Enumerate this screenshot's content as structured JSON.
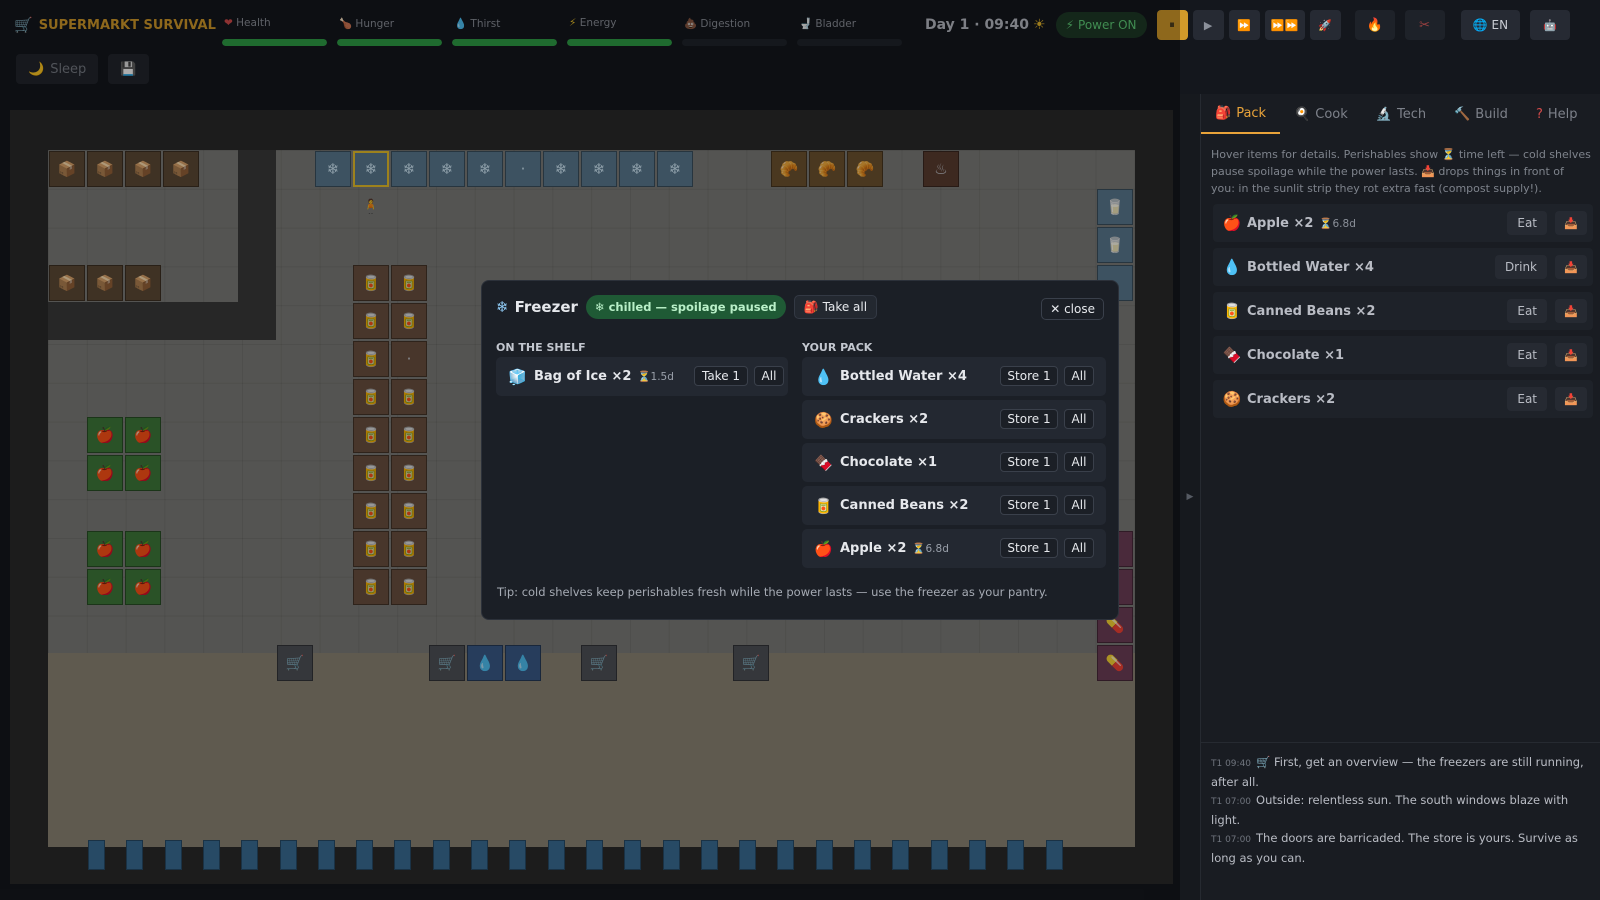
{
  "app": {
    "title": "SUPERMARKT SURVIVAL",
    "title_icon": "cart-icon"
  },
  "stats": [
    {
      "label": "Health",
      "icon": "heart-icon",
      "fill_fraction": 1.0
    },
    {
      "label": "Hunger",
      "icon": "drumstick-icon",
      "fill_fraction": 1.0
    },
    {
      "label": "Thirst",
      "icon": "droplet-icon",
      "fill_fraction": 1.0
    },
    {
      "label": "Energy",
      "icon": "bolt-icon",
      "fill_fraction": 1.0
    },
    {
      "label": "Digestion",
      "icon": "poop-icon",
      "fill_fraction": 0.0
    },
    {
      "label": "Bladder",
      "icon": "toilet-icon",
      "fill_fraction": 0.0
    }
  ],
  "clock": {
    "text": "Day 1 · 09:40"
  },
  "power": {
    "label": "Power ON",
    "color": "#5fce78"
  },
  "speed_controls": {
    "pause": "⏸",
    "play": "▶",
    "fast": "⏩",
    "fastest": "⏩⏩",
    "rocket": "🚀"
  },
  "lang": {
    "label": "EN"
  },
  "toolbar": {
    "sleep_label": "Sleep"
  },
  "modal": {
    "title": "Freezer",
    "badge": "chilled — spoilage paused",
    "take_all": "Take all",
    "close": "close",
    "shelf_title": "ON THE SHELF",
    "pack_title": "YOUR PACK",
    "shelf": [
      {
        "name": "Bag of Ice ×2",
        "time": "1.5d",
        "icon": "ice-icon",
        "take1": "Take 1",
        "all": "All"
      }
    ],
    "pack": [
      {
        "name": "Bottled Water ×4",
        "time": "",
        "icon": "water-drop-icon",
        "store1": "Store 1",
        "all": "All"
      },
      {
        "name": "Crackers ×2",
        "time": "",
        "icon": "crackers-icon",
        "store1": "Store 1",
        "all": "All"
      },
      {
        "name": "Chocolate ×1",
        "time": "",
        "icon": "chocolate-icon",
        "store1": "Store 1",
        "all": "All"
      },
      {
        "name": "Canned Beans ×2",
        "time": "",
        "icon": "can-icon",
        "store1": "Store 1",
        "all": "All"
      },
      {
        "name": "Apple ×2",
        "time": "6.8d",
        "icon": "apple-icon",
        "store1": "Store 1",
        "all": "All"
      }
    ],
    "tip": "Tip: cold shelves keep perishables fresh while the power lasts — use the freezer as your pantry."
  },
  "sidebar": {
    "tabs": [
      {
        "label": "Pack",
        "icon": "backpack-icon"
      },
      {
        "label": "Cook",
        "icon": "pan-icon"
      },
      {
        "label": "Tech",
        "icon": "microscope-icon"
      },
      {
        "label": "Build",
        "icon": "hammer-icon"
      },
      {
        "label": "Help",
        "icon": "question-icon"
      }
    ],
    "hint": "Hover items for details. Perishables show ⏳ time left — cold shelves pause spoilage while the power lasts. 📥 drops things in front of you: in the sunlit strip they rot extra fast (compost supply!).",
    "items": [
      {
        "name": "Apple ×2",
        "time": "6.8d",
        "action": "Eat",
        "icon": "apple-icon"
      },
      {
        "name": "Bottled Water ×4",
        "time": "",
        "action": "Drink",
        "icon": "water-drop-icon"
      },
      {
        "name": "Canned Beans ×2",
        "time": "",
        "action": "Eat",
        "icon": "can-icon"
      },
      {
        "name": "Chocolate ×1",
        "time": "",
        "action": "Eat",
        "icon": "chocolate-icon"
      },
      {
        "name": "Crackers ×2",
        "time": "",
        "action": "Eat",
        "icon": "crackers-icon"
      }
    ],
    "log": [
      {
        "time": "T1 09:40",
        "text": "🛒 First, get an overview — the freezers are still running, after all."
      },
      {
        "time": "T1 07:00",
        "text": "Outside: relentless sun. The south windows blaze with light."
      },
      {
        "time": "T1 07:00",
        "text": "The doors are barricaded. The store is yours. Survive as long as you can."
      }
    ]
  }
}
